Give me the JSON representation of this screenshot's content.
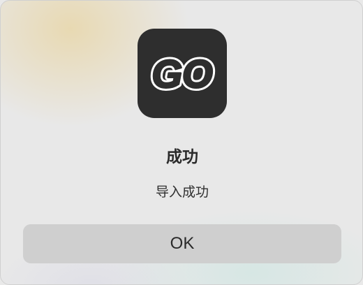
{
  "dialog": {
    "icon": {
      "name": "go-app-icon",
      "logo_text": "GO",
      "background_color": "#2e2e2e",
      "logo_color": "#ffffff"
    },
    "title": "成功",
    "message": "导入成功",
    "ok_label": "OK"
  }
}
